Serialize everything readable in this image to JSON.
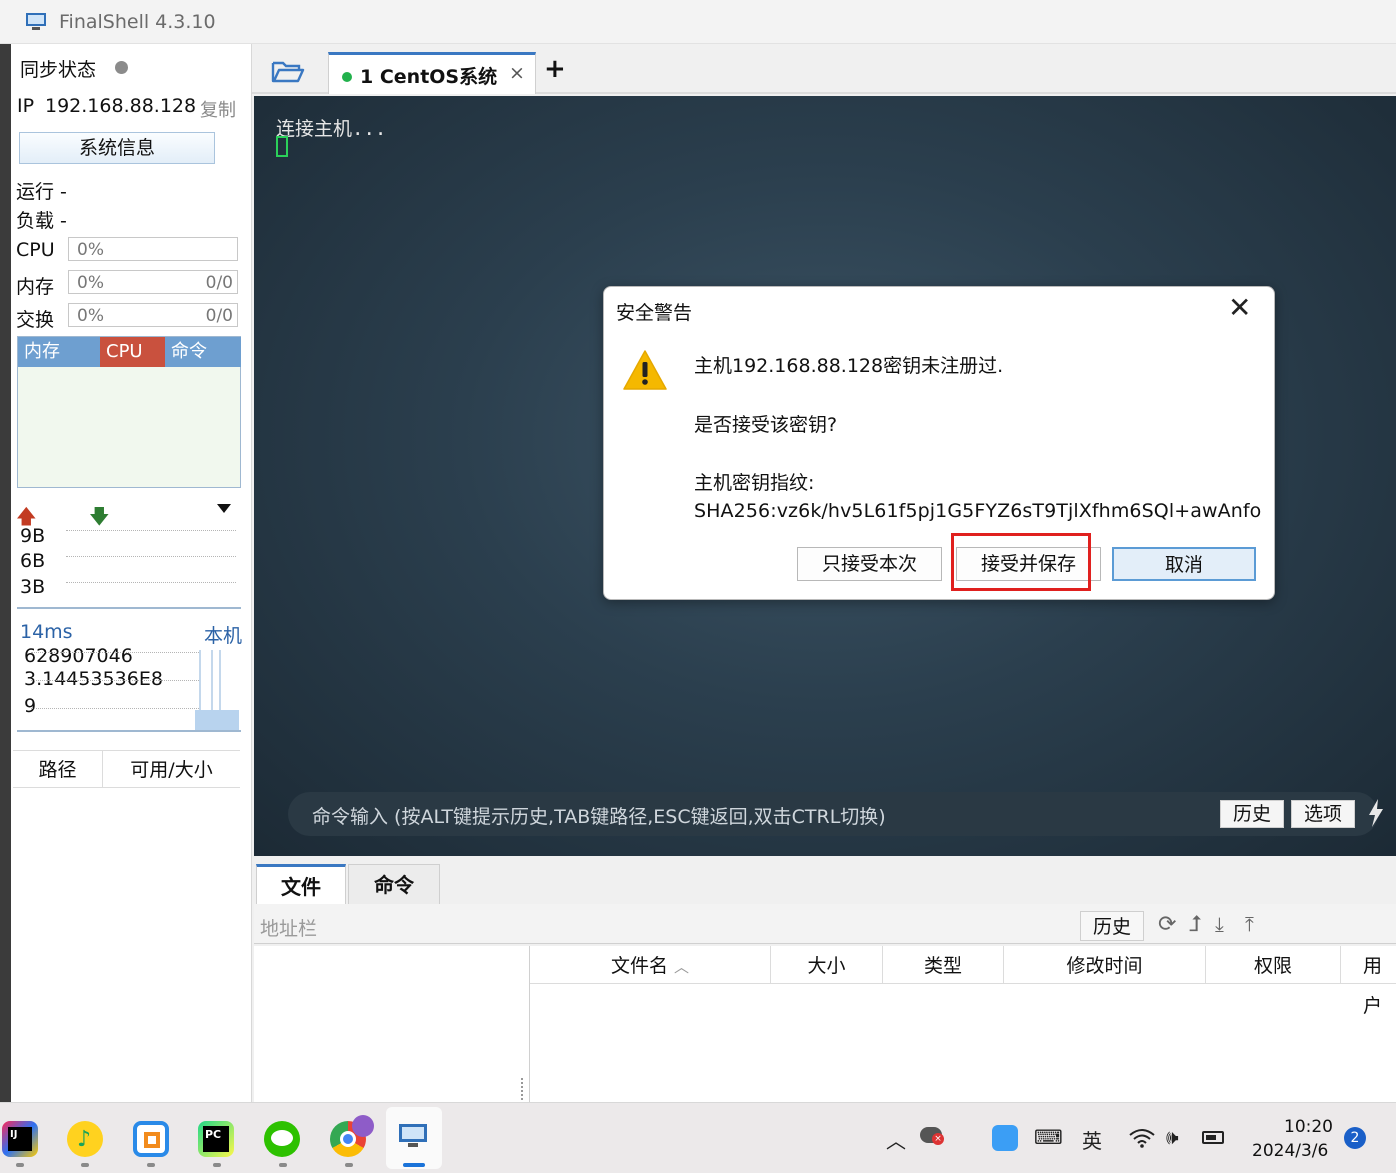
{
  "window": {
    "title": "FinalShell 4.3.10"
  },
  "left_panel": {
    "sync_label": "同步状态",
    "ip_label": "IP",
    "ip_value": "192.168.88.128",
    "copy_label": "复制",
    "sysinfo_button": "系统信息",
    "run_label": "运行 -",
    "load_label": "负载 -",
    "cpu": {
      "label": "CPU",
      "value": "0%"
    },
    "memory": {
      "label": "内存",
      "value": "0%",
      "ratio": "0/0"
    },
    "swap": {
      "label": "交换",
      "value": "0%",
      "ratio": "0/0"
    },
    "mini_tabs": [
      "内存",
      "CPU",
      "命令"
    ],
    "net_scale": [
      "9B",
      "6B",
      "3B"
    ],
    "latency": "14ms",
    "host_label": "本机",
    "stats": [
      "628907046",
      "3.14453536E8",
      "9"
    ],
    "disk_columns": [
      "路径",
      "可用/大小"
    ]
  },
  "session_tab": {
    "label": "1 CentOS系统",
    "status_color": "#22b14c"
  },
  "terminal": {
    "text": "连接主机...",
    "command_placeholder": "命令输入 (按ALT键提示历史,TAB键路径,ESC键返回,双击CTRL切换)",
    "history_button": "历史",
    "options_button": "选项"
  },
  "dialog": {
    "title": "安全警告",
    "line1": "主机192.168.88.128密钥未注册过.",
    "line2": "是否接受该密钥?",
    "line3": "主机密钥指纹:",
    "fingerprint": "SHA256:vz6k/hv5L61f5pj1G5FYZ6sT9TjlXfhm6SQl+awAnfo",
    "btn_once": "只接受本次",
    "btn_save": "接受并保存",
    "btn_cancel": "取消"
  },
  "file_pane": {
    "tabs": [
      "文件",
      "命令"
    ],
    "address_placeholder": "地址栏",
    "history_button": "历史",
    "columns": [
      "文件名",
      "大小",
      "类型",
      "修改时间",
      "权限",
      "用户"
    ]
  },
  "taskbar": {
    "ime": "英",
    "time": "10:20",
    "date": "2024/3/6",
    "notification_count": "2"
  },
  "colors": {
    "accent": "#5b9bd5",
    "highlight": "#e0201e",
    "cpu_tab": "#c9513e"
  }
}
